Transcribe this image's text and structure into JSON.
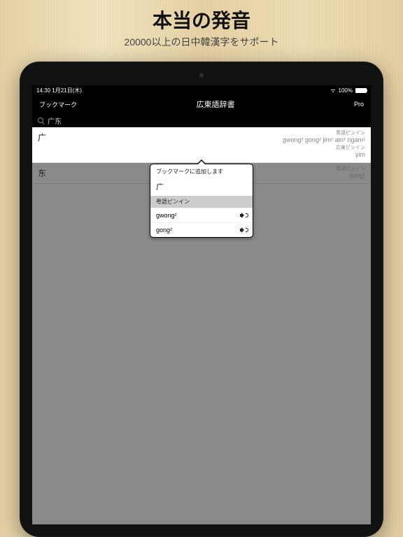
{
  "promo": {
    "title": "本当の発音",
    "subtitle": "20000以上の日中韓漢字をサポート"
  },
  "statusbar": {
    "time": "14:30",
    "date": "1月21日(木)",
    "battery": "100%"
  },
  "navbar": {
    "left": "ブックマーク",
    "title": "広東語辞書",
    "right": "Pro"
  },
  "search": {
    "query": "广东"
  },
  "results": [
    {
      "char": "广",
      "label1": "粤語ピンイン",
      "reading1": "gwong² gong² jim² am¹ ngam¹",
      "label2": "広東ピンイン",
      "reading2": "yim",
      "selected": true
    },
    {
      "char": "东",
      "label1": "粤語ピンイン",
      "reading1": "dung¹",
      "selected": false
    }
  ],
  "popup": {
    "header": "ブックマークに追加します",
    "char": "广",
    "section": "粤語ピンイン",
    "items": [
      {
        "reading": "gwong²"
      },
      {
        "reading": "gong²"
      }
    ]
  }
}
